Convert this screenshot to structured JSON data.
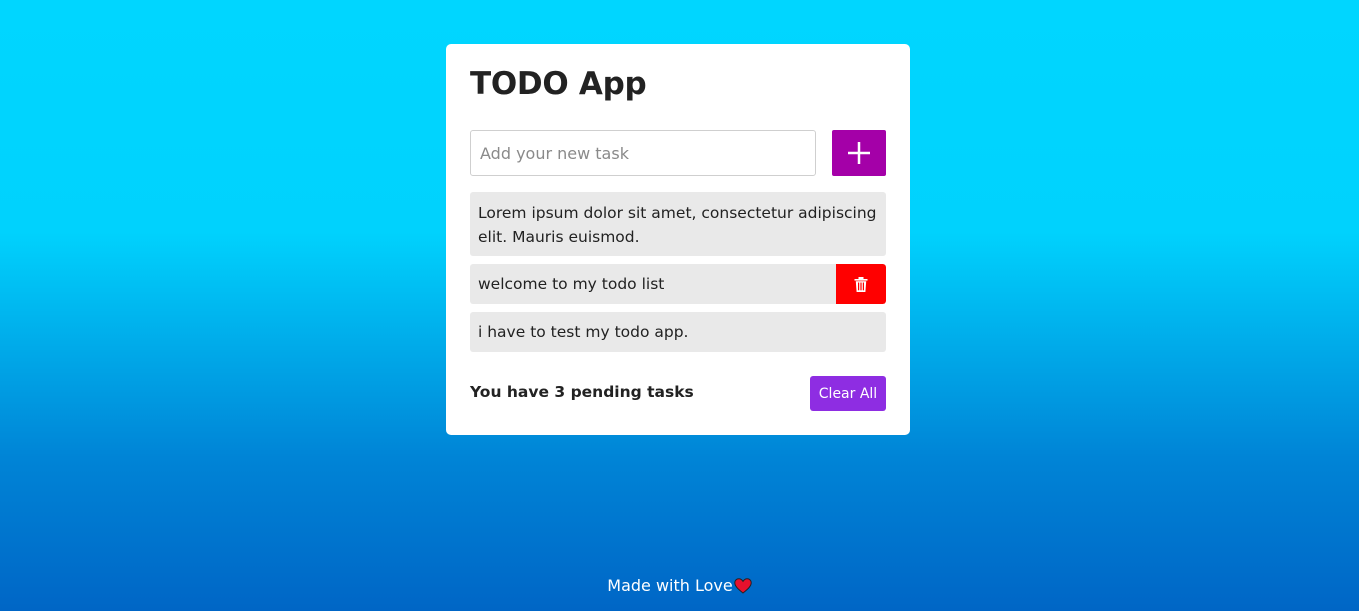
{
  "app": {
    "title": "TODO App"
  },
  "input": {
    "placeholder": "Add your new task",
    "value": ""
  },
  "add_button": {
    "icon": "plus-icon"
  },
  "todos": [
    {
      "text": "Lorem ipsum dolor sit amet, consectetur adipiscing elit. Mauris euismod."
    },
    {
      "text": "welcome to my todo list",
      "delete_icon": "trash-icon"
    },
    {
      "text": "i have to test my todo app."
    }
  ],
  "footer": {
    "pending_text": "You have 3 pending tasks",
    "clear_label": "Clear All"
  },
  "credit": {
    "text": "Made with Love",
    "icon": "heart-icon"
  },
  "colors": {
    "add_button": "#a400a8",
    "delete_button": "#ff0000",
    "clear_button": "#8e2de2",
    "item_background": "#e9e9e9",
    "background_top": "#00d6ff",
    "background_bottom": "#0066c6"
  }
}
